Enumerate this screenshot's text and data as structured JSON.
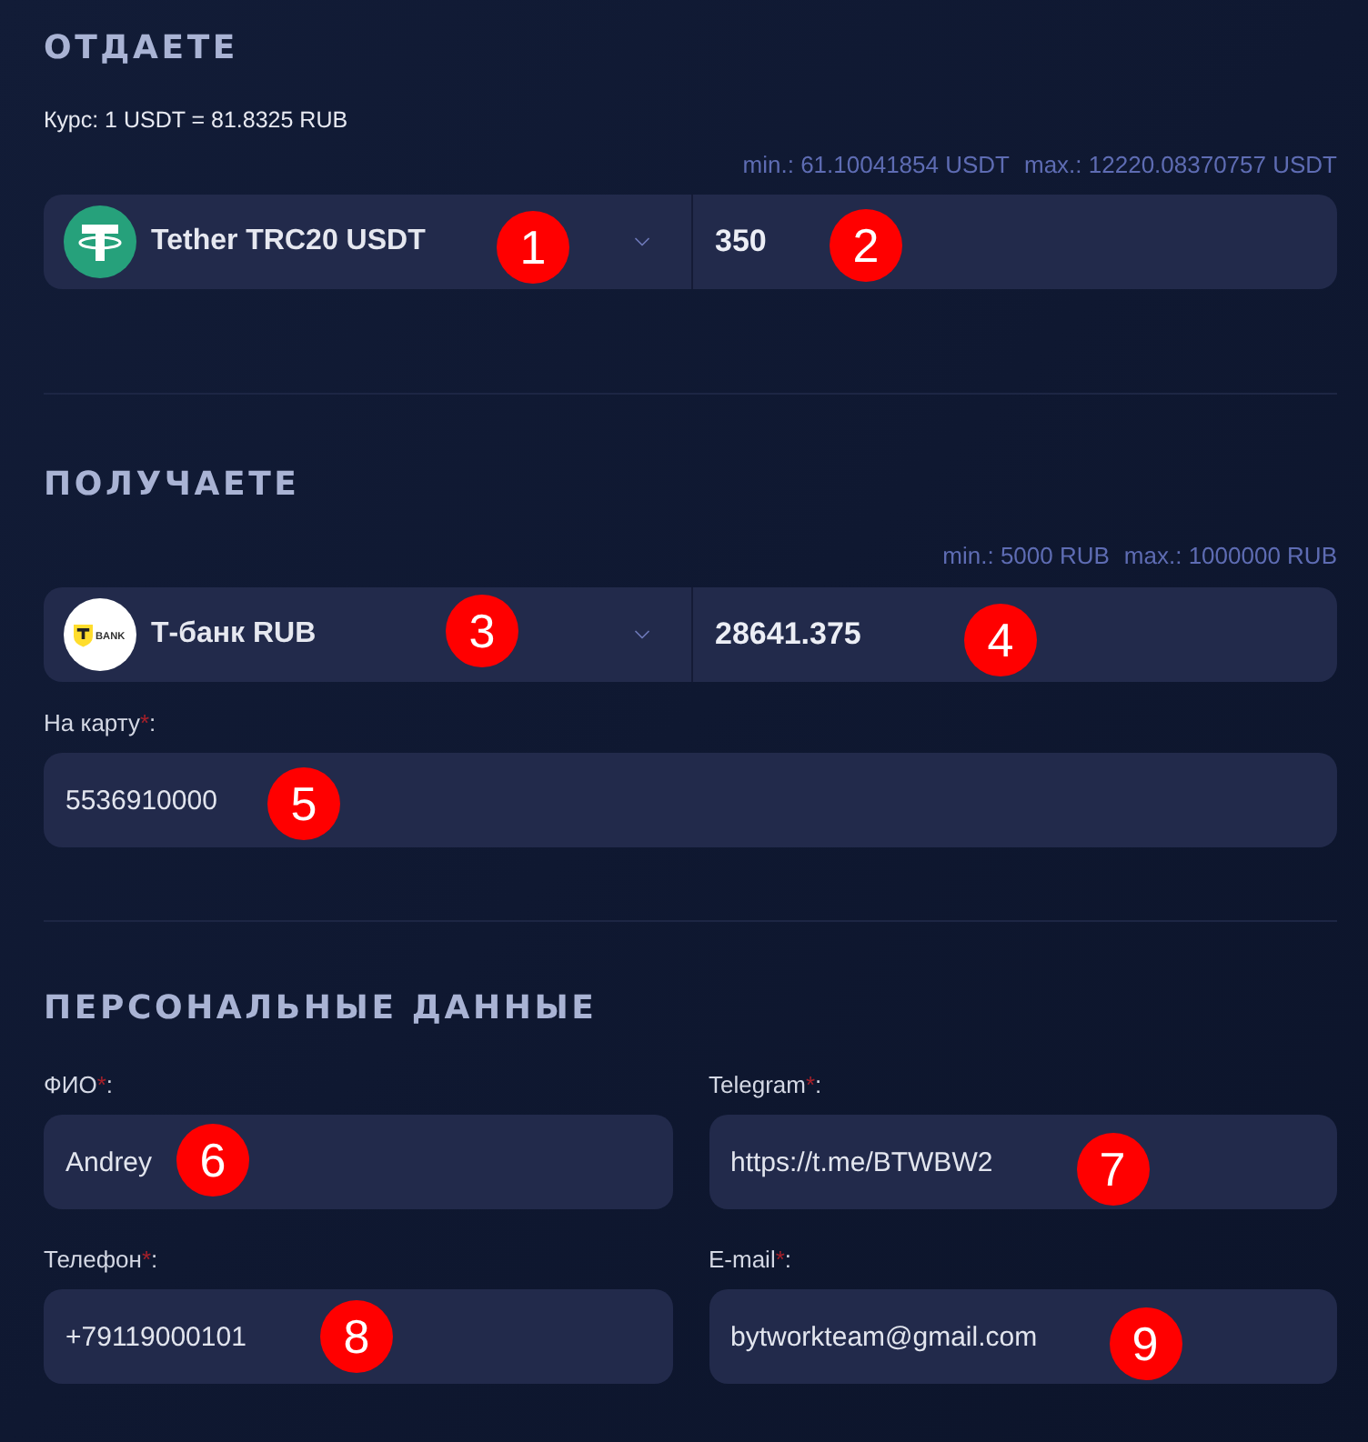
{
  "give": {
    "heading": "ОТДАЕТЕ",
    "rate": "Курс: 1 USDT = 81.8325 RUB",
    "limits": [
      "min.: 61.10041854 USDT",
      "max.: 12220.08370757 USDT"
    ],
    "currency": {
      "name": "Tether TRC20 USDT",
      "kind": "tether",
      "marker": "1"
    },
    "amount": {
      "value": "350",
      "marker": "2"
    }
  },
  "receive": {
    "heading": "ПОЛУЧАЕТЕ",
    "limits": [
      "min.: 5000 RUB",
      "max.: 1000000 RUB"
    ],
    "currency": {
      "name": "Т-банк RUB",
      "kind": "bank",
      "logo_text": "BANK",
      "marker": "3"
    },
    "amount": {
      "value": "28641.375",
      "marker": "4"
    },
    "card": {
      "label": "На карту",
      "required_mark": "*",
      "label_suffix": ":",
      "value": "5536910000",
      "marker": "5"
    }
  },
  "personal": {
    "heading": "ПЕРСОНАЛЬНЫЕ ДАННЫЕ",
    "fields": [
      {
        "label": "ФИО",
        "required_mark": "*",
        "label_suffix": ":",
        "value": "Andrey",
        "marker": "6"
      },
      {
        "label": "Telegram",
        "required_mark": "*",
        "label_suffix": ":",
        "value": "https://t.me/BTWBW2",
        "marker": "7"
      },
      {
        "label": "Телефон",
        "required_mark": "*",
        "label_suffix": ":",
        "value": "+79119000101",
        "marker": "8"
      },
      {
        "label": "E-mail",
        "required_mark": "*",
        "label_suffix": ":",
        "value": "bytworkteam@gmail.com",
        "marker": "9"
      }
    ]
  }
}
